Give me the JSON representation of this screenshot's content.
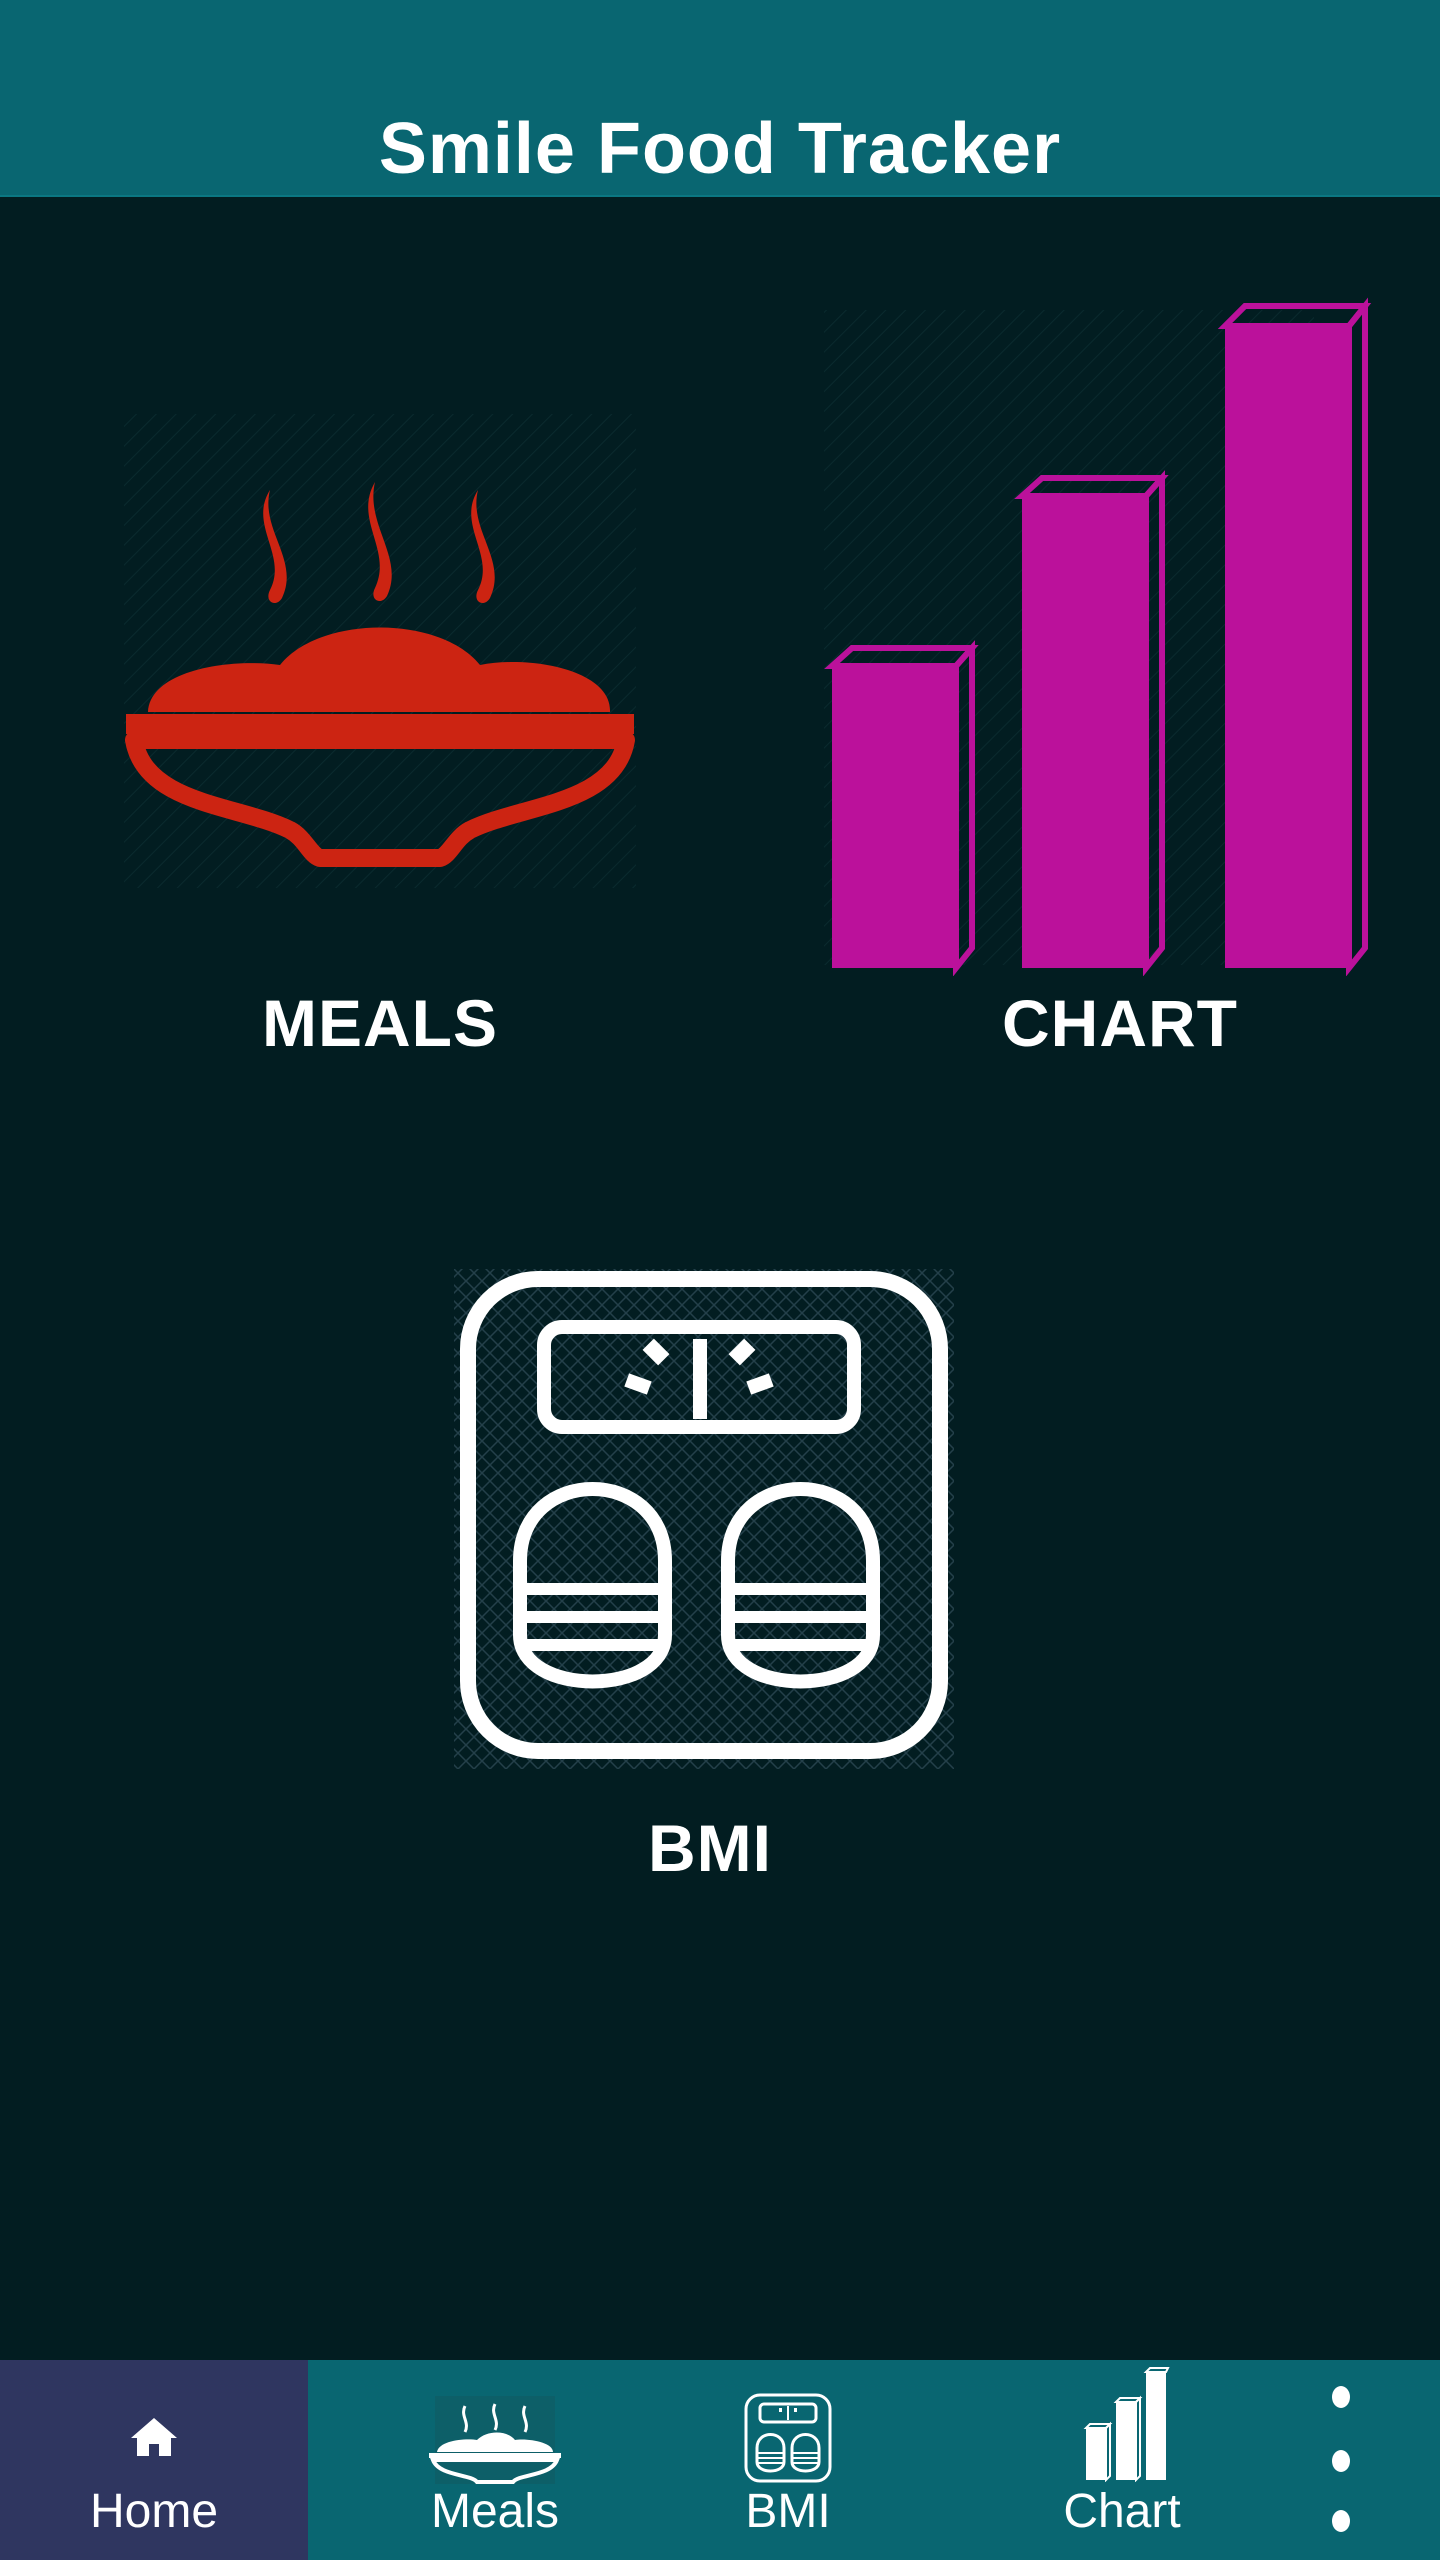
{
  "app_bar": {
    "title": "Smile Food Tracker",
    "background": "#096671"
  },
  "tiles": {
    "meals": {
      "label": "MEALS",
      "icon": "steaming-bowl-icon",
      "color": "#cc2412"
    },
    "chart": {
      "label": "CHART",
      "icon": "bar-chart-icon",
      "color": "#bb119b"
    },
    "bmi": {
      "label": "BMI",
      "icon": "bathroom-scale-icon",
      "color": "#ffffff"
    }
  },
  "bottom_nav": {
    "background": "#096671",
    "active_background": "#2f3660",
    "items": [
      {
        "label": "Home",
        "icon": "home-icon",
        "active": true
      },
      {
        "label": "Meals",
        "icon": "bowl-icon",
        "active": false
      },
      {
        "label": "BMI",
        "icon": "scale-icon",
        "active": false
      },
      {
        "label": "Chart",
        "icon": "bar-chart-icon",
        "active": false
      }
    ],
    "overflow_icon": "more-vertical-icon"
  }
}
